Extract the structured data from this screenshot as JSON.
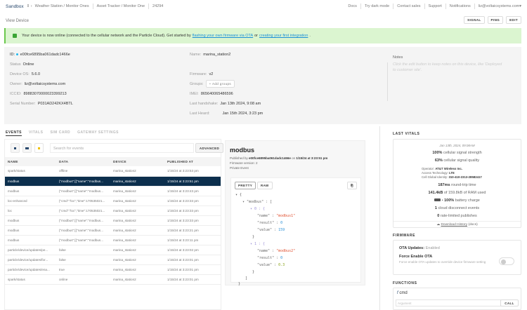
{
  "topbar": {
    "org": "Sandbox",
    "product1": "Weather Station / Monitor Ones",
    "product2": "Asset Tracker / Monitor One",
    "product_id": "24294",
    "links": [
      "Docs",
      "Try dark mode",
      "Contact sales",
      "Support",
      "Notifications"
    ],
    "user": "liz@voltaicsystems.com"
  },
  "page": {
    "title": "View Device",
    "buttons": [
      "SIGNAL",
      "PING",
      "EDIT"
    ]
  },
  "banner": {
    "text": "Your device is now online (connected to the cellular network and the Particle Cloud). Get started by",
    "link1": "flashing your own firmware via OTA",
    "or": "or",
    "link2": "creating your first integration",
    "end": "."
  },
  "info": {
    "id_label": "ID:",
    "id": "e00fce6895ba061dadc1466e",
    "status_label": "Status",
    "status": "Online",
    "os_label": "Device OS:",
    "os": "5.6.0",
    "owner_label": "Owner:",
    "owner": "liz@voltaicsystems.com",
    "iccid_label": "ICCID:",
    "iccid": "89883070000023399213",
    "serial_label": "Serial Number:",
    "serial": "P031AD242KX4BTL",
    "name_label": "Name:",
    "name": "marina_station2",
    "fw_label": "Firmware:",
    "fw": "v2",
    "groups_label": "Groups:",
    "groups_btn": "+ Add groups",
    "imei_label": "IMEI:",
    "imei": "865640065486596",
    "hs_label": "Last handshake:",
    "hs": "Jan 13th 2024, 9:08 am",
    "heard_label": "Last Heard:",
    "heard": "Jan 15th 2024, 3:23 pm",
    "notes_label": "Notes",
    "notes_placeholder": "Click the edit button to keep notes on this device, like 'Deployed to customer site'."
  },
  "tabs": [
    "EVENTS",
    "VITALS",
    "SIM CARD",
    "GATEWAY SETTINGS"
  ],
  "events": {
    "search_placeholder": "Search for events",
    "advanced": "ADVANCED",
    "columns": [
      "NAME",
      "DATA",
      "DEVICE",
      "PUBLISHED AT"
    ],
    "rows": [
      [
        "spark/status",
        "offline",
        "marina_station2",
        "1/15/24 at 3:23:53 pm"
      ],
      [
        "modbus",
        "{\"modbus\":[{\"name\":\"modbus...",
        "marina_station2",
        "1/15/24 at 3:23:51 pm"
      ],
      [
        "modbus",
        "{\"modbus\":[{\"name\":\"modbus...",
        "marina_station2",
        "1/15/24 at 3:23:43 pm"
      ],
      [
        "loc-enhanced",
        "{\"cmd\":\"loc\",\"time\":170535021...",
        "marina_station2",
        "1/15/24 at 3:23:33 pm"
      ],
      [
        "loc",
        "{\"cmd\":\"loc\",\"time\":170535021...",
        "marina_station2",
        "1/15/24 at 3:23:33 pm"
      ],
      [
        "modbus",
        "{\"modbus\":[{\"name\":\"modbus...",
        "marina_station2",
        "1/15/24 at 3:23:33 pm"
      ],
      [
        "modbus",
        "{\"modbus\":[{\"name\":\"modbus...",
        "marina_station2",
        "1/15/24 at 3:23:21 pm"
      ],
      [
        "modbus",
        "{\"modbus\":[{\"name\":\"modbus...",
        "marina_station2",
        "1/15/24 at 3:23:11 pm"
      ],
      [
        "particle/device/updates/pe...",
        "false",
        "marina_station2",
        "1/15/24 at 3:23:02 pm"
      ],
      [
        "particle/device/updates/for...",
        "false",
        "marina_station2",
        "1/15/24 at 3:23:01 pm"
      ],
      [
        "particle/device/updates/ena...",
        "true",
        "marina_station2",
        "1/15/24 at 3:23:01 pm"
      ],
      [
        "spark/status",
        "online",
        "marina_station2",
        "1/15/24 at 3:23:01 pm"
      ]
    ]
  },
  "detail": {
    "title": "modbus",
    "published_by": "Published by",
    "device_id": "e00fce6895ba061dadc1466e",
    "on": "on",
    "time": "1/15/24 at 3:23:51 pm",
    "fw": "Firmware version: 2",
    "private": "Private Event",
    "pretty": "PRETTY",
    "raw": "RAW",
    "json_lines": [
      "▾ {",
      "▾ \"modbus\" : [",
      "▾ 0 : {",
      "\"name\" : ",
      "\"modbus1\"",
      "\"result\" : ",
      "0",
      "\"value\" : ",
      "159",
      "}",
      "▾ 1 : {",
      "\"name\" : ",
      "\"modbus2\"",
      "\"result\" : ",
      "0",
      "\"value\" : ",
      "0.3",
      "}",
      "]",
      "}"
    ]
  },
  "vitals": {
    "title": "LAST VITALS",
    "date": "Jan 13th, 2024, 09:08AM",
    "sig_strength": "100%",
    "sig_strength_t": "cellular signal strength",
    "sig_quality": "63%",
    "sig_quality_t": "cellular signal quality",
    "operator_l": "Operator:",
    "operator": "AT&T Wireless Inc.",
    "tech_l": "Access Technology:",
    "tech": "LTE",
    "cgi_l": "Cell Global Identity:",
    "cgi": "310-410-2313-28582417",
    "rtt": "187ms",
    "rtt_t": "round-trip time",
    "ram": "141.4kB",
    "ram_t": "of 159.8kB of RAM used",
    "battery": "100%",
    "battery_t": "battery charge",
    "disc": "1",
    "disc_t": "cloud disconnect events",
    "rate": "0",
    "rate_t": "rate-limited publishes",
    "download": "Download History",
    "docs": "(docs)"
  },
  "firmware": {
    "title": "FIRMWARE",
    "ota_l": "OTA Updates:",
    "ota": "Enabled",
    "force": "Force Enable OTA",
    "force_desc": "Force enable OTA updates to override device firmware setting"
  },
  "functions": {
    "title": "FUNCTIONS",
    "name": "cmd",
    "placeholder": "Argument",
    "call": "CALL"
  }
}
